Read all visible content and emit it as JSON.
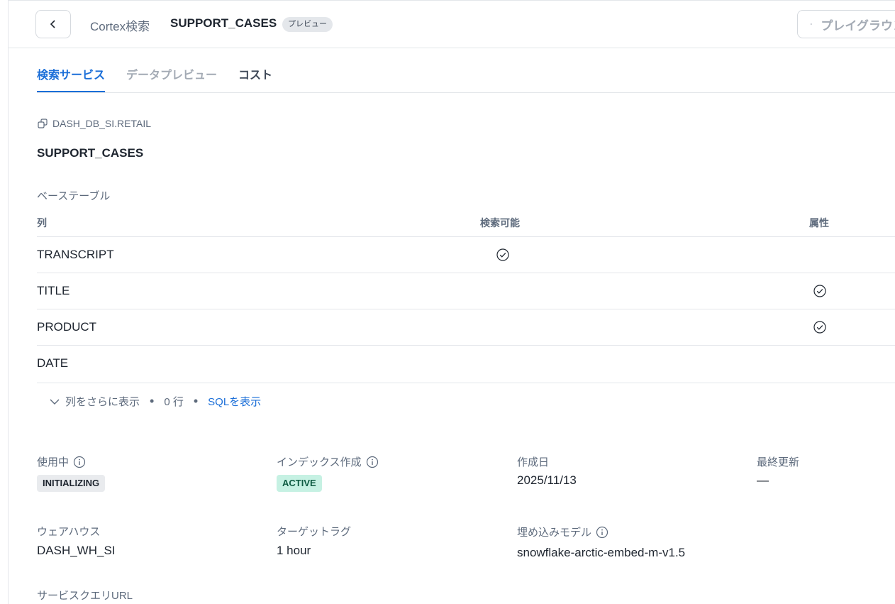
{
  "header": {
    "breadcrumb": "Cortex検索",
    "title": "SUPPORT_CASES",
    "preview_badge": "プレビュー",
    "playground_label": "プレイグラウンド"
  },
  "tabs": [
    {
      "label": "検索サービス",
      "active": true
    },
    {
      "label": "データプレビュー",
      "active": false
    },
    {
      "label": "コスト",
      "active": false
    }
  ],
  "service": {
    "schema": "DASH_DB_SI.RETAIL",
    "name": "SUPPORT_CASES"
  },
  "base_table": {
    "label": "ベーステーブル",
    "headers": {
      "column": "列",
      "searchable": "検索可能",
      "attribute": "属性"
    },
    "rows": [
      {
        "name": "TRANSCRIPT",
        "searchable": true,
        "attribute": false
      },
      {
        "name": "TITLE",
        "searchable": false,
        "attribute": true
      },
      {
        "name": "PRODUCT",
        "searchable": false,
        "attribute": true
      },
      {
        "name": "DATE",
        "searchable": false,
        "attribute": false
      }
    ],
    "show_more": "列をさらに表示",
    "row_count": "0 行",
    "show_sql": "SQLを表示"
  },
  "details": {
    "serving": {
      "label": "使用中",
      "value": "INITIALIZING"
    },
    "indexing": {
      "label": "インデックス作成",
      "value": "ACTIVE"
    },
    "created": {
      "label": "作成日",
      "value": "2025/11/13"
    },
    "last_refresh": {
      "label": "最終更新",
      "value": "—"
    },
    "warehouse": {
      "label": "ウェアハウス",
      "value": "DASH_WH_SI"
    },
    "target_lag": {
      "label": "ターゲットラグ",
      "value": "1 hour"
    },
    "embedding_model": {
      "label": "埋め込みモデル",
      "value": "snowflake-arctic-embed-m-v1.5"
    },
    "query_url": {
      "label": "サービスクエリURL"
    }
  },
  "colors": {
    "accent": "#1a6ed8",
    "active_bg": "#c6f1e3",
    "init_bg": "#e9ebee"
  }
}
